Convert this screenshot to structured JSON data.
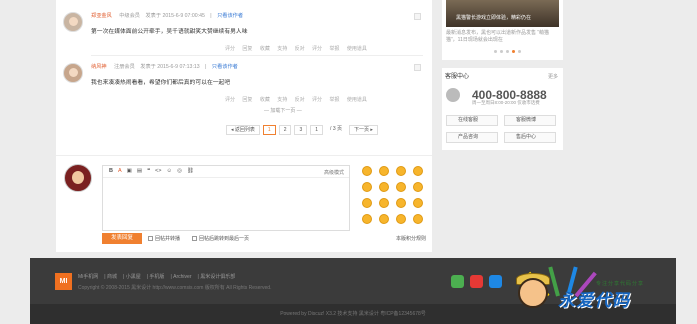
{
  "thread": {
    "posts": [
      {
        "user": "郑亚金风",
        "level": "中级会员",
        "posted": "发表于 2015-6-9 07:00:45",
        "view_author": "只看该作者",
        "text": "第一次在媒体面前公开牵手，吴千语就甜笑大赞继续有男人味",
        "ops": [
          "评分",
          "回复",
          "收藏",
          "支持",
          "反对",
          "评分",
          "举报",
          "使用道具"
        ]
      },
      {
        "user": "纳风神",
        "level": "注册会员",
        "posted": "发表于 2015-6-9 07:13:13",
        "view_author": "只看该作者",
        "text": "我也来凑凑热闹看看，希望你们都后真的可以在一起吧",
        "ops": [
          "评分",
          "回复",
          "收藏",
          "支持",
          "反对",
          "评分",
          "举报",
          "使用道具"
        ]
      }
    ],
    "load_more": "加载下一页",
    "pager": {
      "prev": "返回列表",
      "pages": [
        "1",
        "2",
        "3"
      ],
      "current_input": "1",
      "total": "/ 3 页",
      "next": "下一页"
    }
  },
  "reply": {
    "mode": "高级模式",
    "toolbar": [
      "B",
      "A",
      "▣",
      "▤",
      "❝",
      "<>",
      "☺",
      "◎",
      "⛓"
    ],
    "submit": "发表回复",
    "check_1": "回帖并转播",
    "check_2": "回帖后跳转到最后一页",
    "rules": "本版积分规则"
  },
  "sidebar": {
    "banner_text": "黑猫警长游戏立即体验，精彩仍在",
    "banner_caption": "最新消息发布，黑也可以出道新作品发售 “萌猫猫”，11日现场就会出现在",
    "service": {
      "title": "客服中心",
      "more": "更多",
      "phone": "400-800-8888",
      "hours": "周一至周日8:00-20:00 仅收市话费",
      "buttons": [
        "在线客服",
        "客服微博",
        "产品咨询",
        "售后中心"
      ]
    }
  },
  "footer": {
    "logo": "MI",
    "links": [
      "Mi手机网",
      "商城",
      "小黑屋",
      "手机版",
      "Archiver",
      "黑米设计俱乐部"
    ],
    "copyright": "Copyright © 2008-2015 黑米设计 http://www.comsis.com 版权所有 All Rights Reserved.",
    "bottom": "Powered by Discuz! X3.2   技术支持   黑米设计   粤ICP备12345678号"
  },
  "watermark": {
    "title": "永爱代码",
    "sub": "专注分享代码分享"
  },
  "colors": {
    "accent": "#f08030",
    "link": "#3a7bd5",
    "footer_bg": "#3b3b3b"
  }
}
